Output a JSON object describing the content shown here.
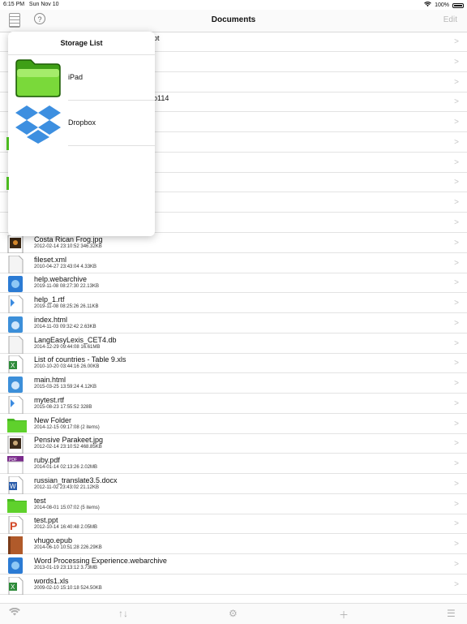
{
  "status": {
    "time": "6:15 PM",
    "date": "Sun Nov 10",
    "battery": "100%"
  },
  "nav": {
    "title": "Documents",
    "edit": "Edit",
    "help_label": "?"
  },
  "popover": {
    "title": "Storage List",
    "items": [
      {
        "label": "iPad",
        "icon": "folder-icon"
      },
      {
        "label": "Dropbox",
        "icon": "dropbox-icon"
      }
    ]
  },
  "files": [
    {
      "name": "Costa Rican Frog.jpg",
      "meta": "2012-02-14 23:10:52  346.32KB",
      "icon": "image"
    },
    {
      "name": "fileset.xml",
      "meta": "2010-04-27 23:43:04  4.33KB",
      "icon": "doc"
    },
    {
      "name": "help.webarchive",
      "meta": "2019-11-08 08:27:30  22.13KB",
      "icon": "web"
    },
    {
      "name": "help_1.rtf",
      "meta": "2019-11-08 08:25:26  26.11KB",
      "icon": "rtf"
    },
    {
      "name": "index.html",
      "meta": "2014-11-03 09:32:42  2.63KB",
      "icon": "html"
    },
    {
      "name": "LangEasyLexis_CET4.db",
      "meta": "2014-12-29 09:44:08  16.61MB",
      "icon": "doc"
    },
    {
      "name": "List of countries - Table 9.xls",
      "meta": "2010-10-20 03:44:16  26.00KB",
      "icon": "xls"
    },
    {
      "name": "main.html",
      "meta": "2015-03-25 13:59:24  4.12KB",
      "icon": "html"
    },
    {
      "name": "mytest.rtf",
      "meta": "2015-08-23 17:55:52  328B",
      "icon": "rtf"
    },
    {
      "name": "New Folder",
      "meta": "2014-12-15 09:17:08 (2 items)",
      "icon": "folder"
    },
    {
      "name": "Pensive Parakeet.jpg",
      "meta": "2012-02-14 23:10:52  468.85KB",
      "icon": "image"
    },
    {
      "name": "ruby.pdf",
      "meta": "2014-01-14 02:13:26  2.02MB",
      "icon": "pdf"
    },
    {
      "name": "russian_translate3.5.docx",
      "meta": "2012-11-02 23:43:02  21.12KB",
      "icon": "word"
    },
    {
      "name": "test",
      "meta": "2014-08-01 15:07:02 (5 items)",
      "icon": "folder"
    },
    {
      "name": "test.ppt",
      "meta": "2012-10-14 16:40:48  2.05MB",
      "icon": "ppt"
    },
    {
      "name": "vhugo.epub",
      "meta": "2014-06-10 10:51:28  226.29KB",
      "icon": "epub"
    },
    {
      "name": "Word Processing Experience.webarchive",
      "meta": "2013-01-19 23:13:12  3.73MB",
      "icon": "web"
    },
    {
      "name": "words1.xls",
      "meta": "2009-02-10 15:10:18  524.50KB",
      "icon": "xls"
    }
  ],
  "hidden_rows": [
    {
      "name": "pt"
    },
    {
      "name": ""
    },
    {
      "name": ""
    },
    {
      "name": "o114"
    },
    {
      "name": ""
    },
    {
      "name": ""
    },
    {
      "name": ""
    },
    {
      "name": ""
    },
    {
      "name": ""
    },
    {
      "name": ""
    }
  ],
  "toolbar": {
    "items": [
      "wifi-icon",
      "sort-icon",
      "gear-icon",
      "plus-icon",
      "stack-icon"
    ]
  }
}
